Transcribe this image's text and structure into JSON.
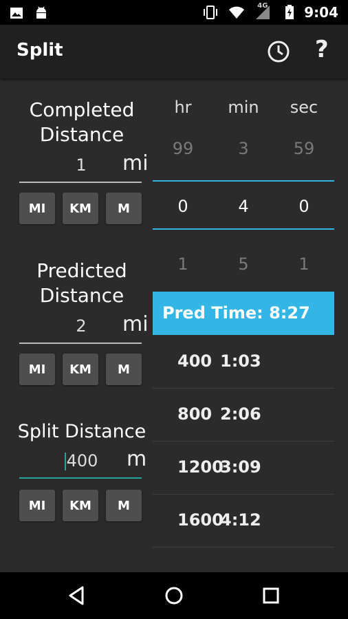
{
  "status_bar": {
    "network_label": "4G",
    "time": "9:04",
    "icons": [
      "gallery-icon",
      "android-icon",
      "vibrate-icon",
      "wifi-icon",
      "signal-icon",
      "battery-charging-icon"
    ]
  },
  "app_bar": {
    "title": "Split",
    "history_icon": "history-clock-icon",
    "help_label": "?"
  },
  "completed": {
    "label_line1": "Completed",
    "label_line2": "Distance",
    "value": "1",
    "unit": "mi"
  },
  "predicted": {
    "label_line1": "Predicted",
    "label_line2": "Distance",
    "value": "2",
    "unit": "mi"
  },
  "split": {
    "label": "Split Distance",
    "value": "400",
    "unit": "m"
  },
  "unit_buttons": [
    "MI",
    "KM",
    "M"
  ],
  "time_picker": {
    "headers": [
      "hr",
      "min",
      "sec"
    ],
    "above": [
      "99",
      "3",
      "59"
    ],
    "selected": [
      "0",
      "4",
      "0"
    ],
    "below": [
      "1",
      "5",
      "1"
    ]
  },
  "predicted_time": "Pred Time: 8:27",
  "splits": [
    {
      "distance": "400",
      "time": "1:03"
    },
    {
      "distance": "800",
      "time": "2:06"
    },
    {
      "distance": "1200",
      "time": "3:09"
    },
    {
      "distance": "1600",
      "time": "4:12"
    }
  ],
  "nav_bar": {
    "icons": [
      "back-icon",
      "home-icon",
      "recents-icon"
    ]
  }
}
